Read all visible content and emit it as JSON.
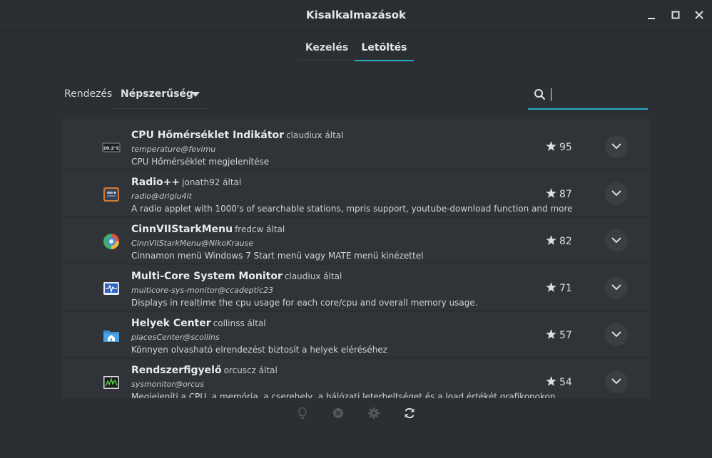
{
  "window": {
    "title": "Kisalkalmazások",
    "controls": [
      "minimize-icon",
      "maximize-icon",
      "close-icon"
    ]
  },
  "tabs": [
    {
      "label": "Kezelés",
      "active": false
    },
    {
      "label": "Letöltés",
      "active": true
    }
  ],
  "toolbar": {
    "sort_label": "Rendezés",
    "sort_value": "Népszerűség",
    "search_value": "",
    "search_icon": "search-icon"
  },
  "applets": [
    {
      "name": "CPU Hőmérséklet Indikátor",
      "author": "claudiux által",
      "uuid": "temperature@fevimu",
      "description": "CPU Hőmérséklet megjelenítése",
      "score": "95",
      "icon": "temperature-icon"
    },
    {
      "name": "Radio++",
      "author": "jonath92 által",
      "uuid": "radio@driglu4it",
      "description": "A radio applet with 1000's of searchable stations, mpris support, youtube-download function and more",
      "score": "87",
      "icon": "radio-icon"
    },
    {
      "name": "CinnVIIStarkMenu",
      "author": "fredcw által",
      "uuid": "CinnVIIStarkMenu@NikoKrause",
      "description": "Cinnamon menü Windows 7 Start menü vagy MATE menü kinézettel",
      "score": "82",
      "icon": "menu-icon"
    },
    {
      "name": "Multi-Core System Monitor",
      "author": "claudiux által",
      "uuid": "multicore-sys-monitor@ccadeptic23",
      "description": "Displays in realtime the cpu usage for each core/cpu and overall memory usage.",
      "score": "71",
      "icon": "system-monitor-icon"
    },
    {
      "name": "Helyek Center",
      "author": "collinss által",
      "uuid": "placesCenter@scollins",
      "description": "Könnyen olvasható elrendezést biztosít a helyek eléréséhez",
      "score": "57",
      "icon": "home-folder-icon"
    },
    {
      "name": "Rendszerfigyelő",
      "author": "orcuscz által",
      "uuid": "sysmonitor@orcus",
      "description": "Megjeleníti a CPU, a memória, a cserehely, a hálózati leterheltséget és a load értékét grafikonokon",
      "score": "54",
      "icon": "graph-icon"
    }
  ],
  "icons": {
    "temperature_text": "20.2°C"
  },
  "bottom_icons": [
    "lightbulb-icon",
    "remove-icon",
    "settings-icon",
    "refresh-icon"
  ],
  "colors": {
    "accent": "#27b0c5",
    "background": "#2b2e32",
    "row": "#303337"
  }
}
